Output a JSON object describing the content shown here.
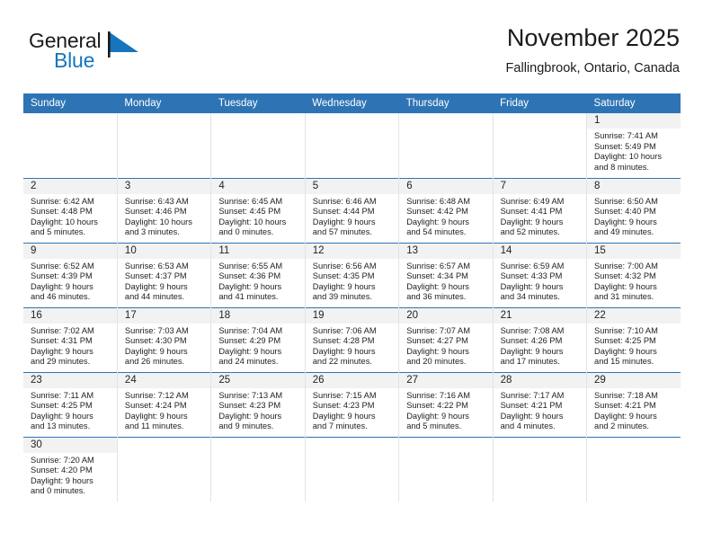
{
  "brand": {
    "name_top": "General",
    "name_bottom": "Blue",
    "flag_color": "#1675bd"
  },
  "header": {
    "title": "November 2025",
    "subtitle": "Fallingbrook, Ontario, Canada"
  },
  "colors": {
    "header_blue": "#2e74b5",
    "daynum_band": "#f2f2f2",
    "text": "#222222"
  },
  "weekday_headers": [
    "Sunday",
    "Monday",
    "Tuesday",
    "Wednesday",
    "Thursday",
    "Friday",
    "Saturday"
  ],
  "weeks": [
    [
      {
        "blank": true
      },
      {
        "blank": true
      },
      {
        "blank": true
      },
      {
        "blank": true
      },
      {
        "blank": true
      },
      {
        "blank": true
      },
      {
        "day": "1",
        "sunrise": "Sunrise: 7:41 AM",
        "sunset": "Sunset: 5:49 PM",
        "daylight1": "Daylight: 10 hours",
        "daylight2": "and 8 minutes."
      }
    ],
    [
      {
        "day": "2",
        "sunrise": "Sunrise: 6:42 AM",
        "sunset": "Sunset: 4:48 PM",
        "daylight1": "Daylight: 10 hours",
        "daylight2": "and 5 minutes."
      },
      {
        "day": "3",
        "sunrise": "Sunrise: 6:43 AM",
        "sunset": "Sunset: 4:46 PM",
        "daylight1": "Daylight: 10 hours",
        "daylight2": "and 3 minutes."
      },
      {
        "day": "4",
        "sunrise": "Sunrise: 6:45 AM",
        "sunset": "Sunset: 4:45 PM",
        "daylight1": "Daylight: 10 hours",
        "daylight2": "and 0 minutes."
      },
      {
        "day": "5",
        "sunrise": "Sunrise: 6:46 AM",
        "sunset": "Sunset: 4:44 PM",
        "daylight1": "Daylight: 9 hours",
        "daylight2": "and 57 minutes."
      },
      {
        "day": "6",
        "sunrise": "Sunrise: 6:48 AM",
        "sunset": "Sunset: 4:42 PM",
        "daylight1": "Daylight: 9 hours",
        "daylight2": "and 54 minutes."
      },
      {
        "day": "7",
        "sunrise": "Sunrise: 6:49 AM",
        "sunset": "Sunset: 4:41 PM",
        "daylight1": "Daylight: 9 hours",
        "daylight2": "and 52 minutes."
      },
      {
        "day": "8",
        "sunrise": "Sunrise: 6:50 AM",
        "sunset": "Sunset: 4:40 PM",
        "daylight1": "Daylight: 9 hours",
        "daylight2": "and 49 minutes."
      }
    ],
    [
      {
        "day": "9",
        "sunrise": "Sunrise: 6:52 AM",
        "sunset": "Sunset: 4:39 PM",
        "daylight1": "Daylight: 9 hours",
        "daylight2": "and 46 minutes."
      },
      {
        "day": "10",
        "sunrise": "Sunrise: 6:53 AM",
        "sunset": "Sunset: 4:37 PM",
        "daylight1": "Daylight: 9 hours",
        "daylight2": "and 44 minutes."
      },
      {
        "day": "11",
        "sunrise": "Sunrise: 6:55 AM",
        "sunset": "Sunset: 4:36 PM",
        "daylight1": "Daylight: 9 hours",
        "daylight2": "and 41 minutes."
      },
      {
        "day": "12",
        "sunrise": "Sunrise: 6:56 AM",
        "sunset": "Sunset: 4:35 PM",
        "daylight1": "Daylight: 9 hours",
        "daylight2": "and 39 minutes."
      },
      {
        "day": "13",
        "sunrise": "Sunrise: 6:57 AM",
        "sunset": "Sunset: 4:34 PM",
        "daylight1": "Daylight: 9 hours",
        "daylight2": "and 36 minutes."
      },
      {
        "day": "14",
        "sunrise": "Sunrise: 6:59 AM",
        "sunset": "Sunset: 4:33 PM",
        "daylight1": "Daylight: 9 hours",
        "daylight2": "and 34 minutes."
      },
      {
        "day": "15",
        "sunrise": "Sunrise: 7:00 AM",
        "sunset": "Sunset: 4:32 PM",
        "daylight1": "Daylight: 9 hours",
        "daylight2": "and 31 minutes."
      }
    ],
    [
      {
        "day": "16",
        "sunrise": "Sunrise: 7:02 AM",
        "sunset": "Sunset: 4:31 PM",
        "daylight1": "Daylight: 9 hours",
        "daylight2": "and 29 minutes."
      },
      {
        "day": "17",
        "sunrise": "Sunrise: 7:03 AM",
        "sunset": "Sunset: 4:30 PM",
        "daylight1": "Daylight: 9 hours",
        "daylight2": "and 26 minutes."
      },
      {
        "day": "18",
        "sunrise": "Sunrise: 7:04 AM",
        "sunset": "Sunset: 4:29 PM",
        "daylight1": "Daylight: 9 hours",
        "daylight2": "and 24 minutes."
      },
      {
        "day": "19",
        "sunrise": "Sunrise: 7:06 AM",
        "sunset": "Sunset: 4:28 PM",
        "daylight1": "Daylight: 9 hours",
        "daylight2": "and 22 minutes."
      },
      {
        "day": "20",
        "sunrise": "Sunrise: 7:07 AM",
        "sunset": "Sunset: 4:27 PM",
        "daylight1": "Daylight: 9 hours",
        "daylight2": "and 20 minutes."
      },
      {
        "day": "21",
        "sunrise": "Sunrise: 7:08 AM",
        "sunset": "Sunset: 4:26 PM",
        "daylight1": "Daylight: 9 hours",
        "daylight2": "and 17 minutes."
      },
      {
        "day": "22",
        "sunrise": "Sunrise: 7:10 AM",
        "sunset": "Sunset: 4:25 PM",
        "daylight1": "Daylight: 9 hours",
        "daylight2": "and 15 minutes."
      }
    ],
    [
      {
        "day": "23",
        "sunrise": "Sunrise: 7:11 AM",
        "sunset": "Sunset: 4:25 PM",
        "daylight1": "Daylight: 9 hours",
        "daylight2": "and 13 minutes."
      },
      {
        "day": "24",
        "sunrise": "Sunrise: 7:12 AM",
        "sunset": "Sunset: 4:24 PM",
        "daylight1": "Daylight: 9 hours",
        "daylight2": "and 11 minutes."
      },
      {
        "day": "25",
        "sunrise": "Sunrise: 7:13 AM",
        "sunset": "Sunset: 4:23 PM",
        "daylight1": "Daylight: 9 hours",
        "daylight2": "and 9 minutes."
      },
      {
        "day": "26",
        "sunrise": "Sunrise: 7:15 AM",
        "sunset": "Sunset: 4:23 PM",
        "daylight1": "Daylight: 9 hours",
        "daylight2": "and 7 minutes."
      },
      {
        "day": "27",
        "sunrise": "Sunrise: 7:16 AM",
        "sunset": "Sunset: 4:22 PM",
        "daylight1": "Daylight: 9 hours",
        "daylight2": "and 5 minutes."
      },
      {
        "day": "28",
        "sunrise": "Sunrise: 7:17 AM",
        "sunset": "Sunset: 4:21 PM",
        "daylight1": "Daylight: 9 hours",
        "daylight2": "and 4 minutes."
      },
      {
        "day": "29",
        "sunrise": "Sunrise: 7:18 AM",
        "sunset": "Sunset: 4:21 PM",
        "daylight1": "Daylight: 9 hours",
        "daylight2": "and 2 minutes."
      }
    ],
    [
      {
        "day": "30",
        "sunrise": "Sunrise: 7:20 AM",
        "sunset": "Sunset: 4:20 PM",
        "daylight1": "Daylight: 9 hours",
        "daylight2": "and 0 minutes."
      },
      {
        "blank": true
      },
      {
        "blank": true
      },
      {
        "blank": true
      },
      {
        "blank": true
      },
      {
        "blank": true
      },
      {
        "blank": true
      }
    ]
  ]
}
